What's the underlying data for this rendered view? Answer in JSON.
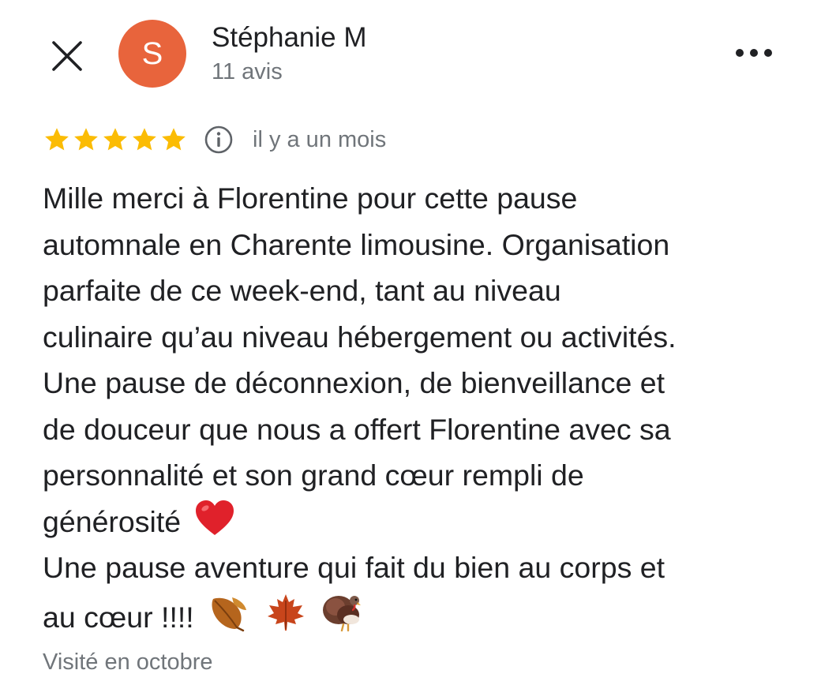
{
  "header": {
    "close_icon": "close-icon",
    "avatar": {
      "initial": "S",
      "color": "#e8643c"
    },
    "author_name": "Stéphanie M",
    "review_count": "11 avis",
    "more_icon": "more-horizontal-icon"
  },
  "rating": {
    "stars": 5,
    "max_stars": 5,
    "star_color": "#fbbc04",
    "info_icon": "info-icon",
    "time_ago": "il y a un mois"
  },
  "review": {
    "lines": [
      "Mille merci à Florentine pour cette pause",
      "automnale en Charente limousine. Organisation",
      "parfaite de ce week-end, tant au niveau",
      "culinaire qu’au niveau hébergement ou activités.",
      "Une pause de déconnexion, de bienveillance et",
      "de douceur que nous a offert Florentine avec sa",
      "personnalité et son grand cœur rempli de",
      "générosité",
      "Une pause aventure qui fait du bien au corps et",
      "au cœur !!!!"
    ],
    "heart_emoji": "heart-emoji",
    "end_emojis": [
      "fallen-leaf-emoji",
      "maple-leaf-emoji",
      "turkey-emoji"
    ]
  },
  "visited": "Visité en octobre"
}
